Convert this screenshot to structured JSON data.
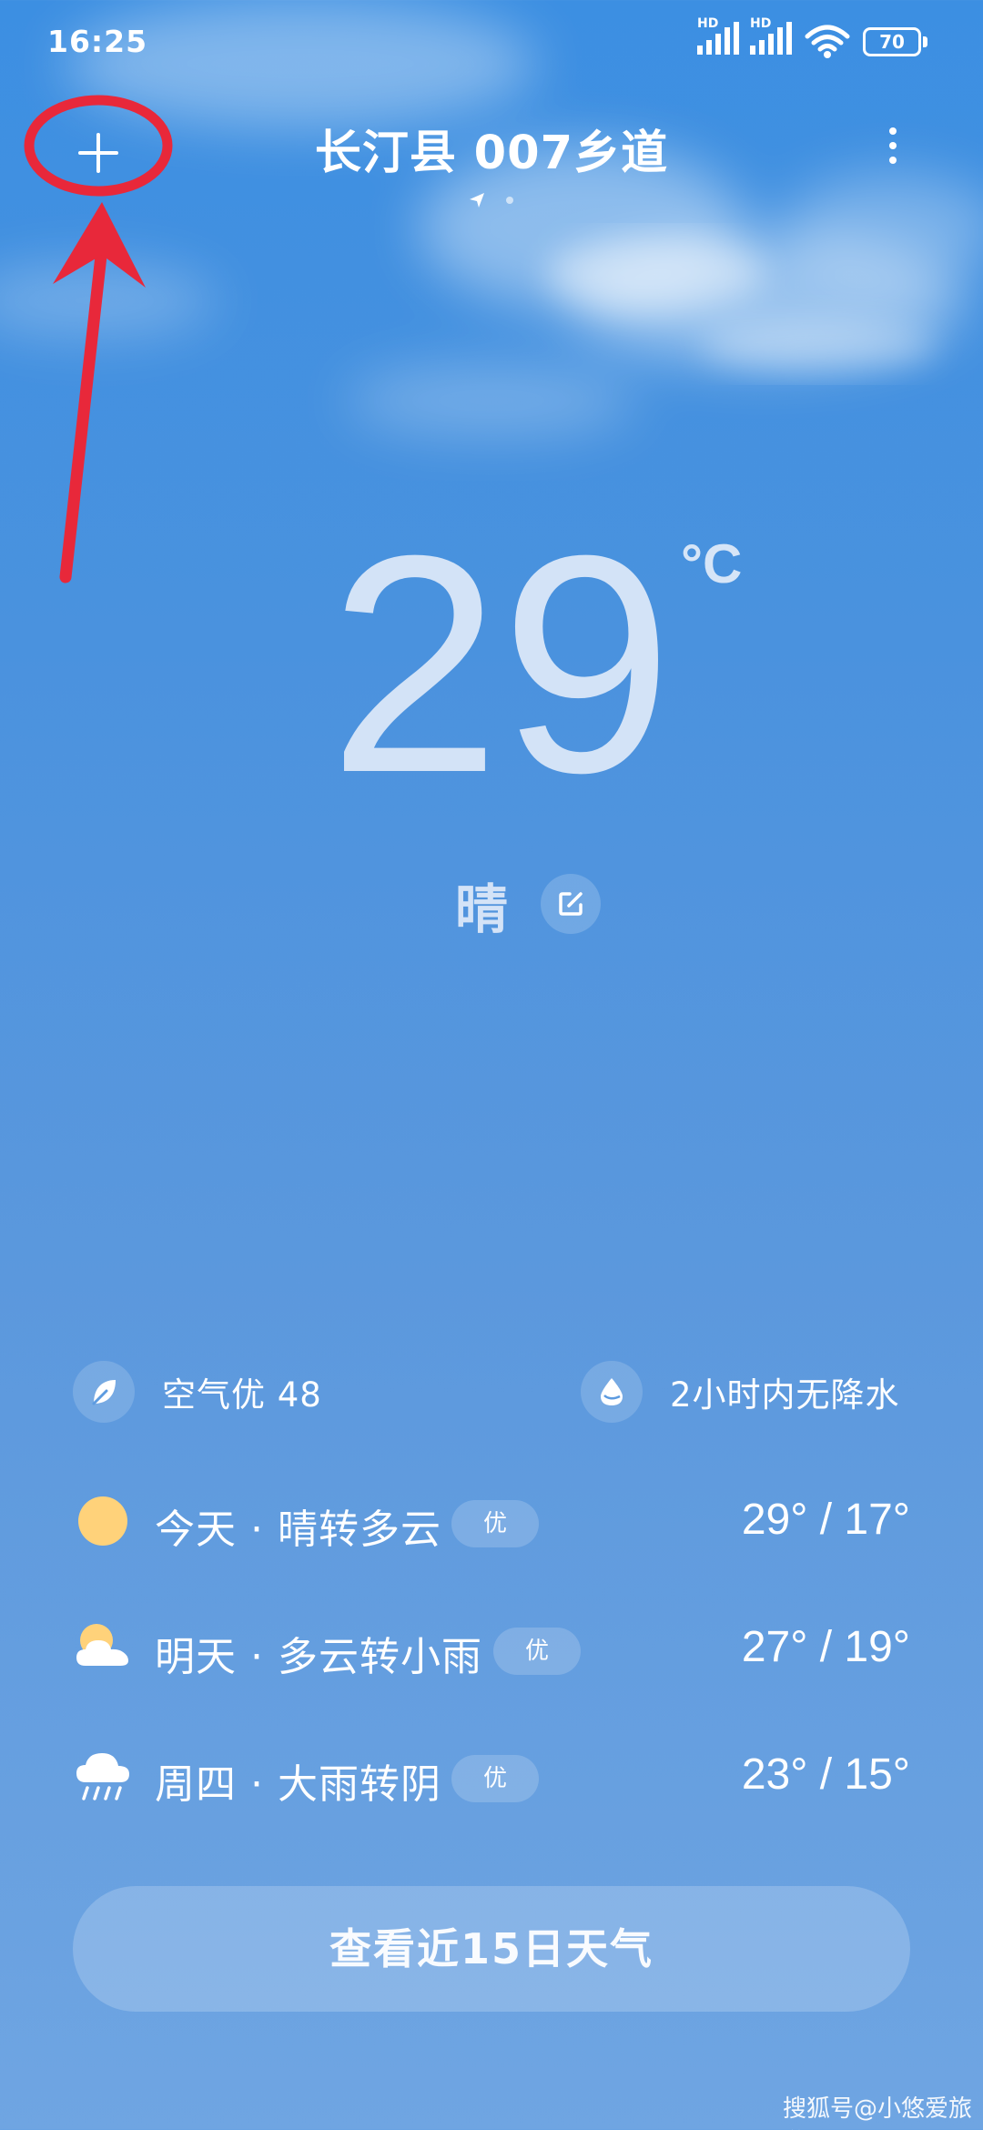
{
  "status_bar": {
    "time": "16:25",
    "signal_1_label": "HD",
    "signal_2_label": "HD",
    "battery": "70"
  },
  "header": {
    "add_icon": "plus-icon",
    "location": "长汀县 007乡道",
    "more_icon": "more-vertical-icon"
  },
  "current": {
    "temperature": "29",
    "unit": "°C",
    "condition": "晴"
  },
  "info": {
    "air_quality": "空气优 48",
    "precipitation": "2小时内无降水"
  },
  "forecast": [
    {
      "icon": "sunny-icon",
      "day": "今天 · 晴转多云",
      "aqi": "优",
      "temp": "29° / 17°"
    },
    {
      "icon": "partly-cloudy-icon",
      "day": "明天 · 多云转小雨",
      "aqi": "优",
      "temp": "27° / 19°"
    },
    {
      "icon": "rain-icon",
      "day": "周四 · 大雨转阴",
      "aqi": "优",
      "temp": "23° / 15°"
    }
  ],
  "cta_label": "查看近15日天气",
  "watermark": "搜狐号@小悠爱旅游",
  "colors": {
    "sky_top": "#3c8fe2",
    "sky_bottom": "#6fa5e2",
    "annotation_red": "#e8283a",
    "sun_yellow": "#ffd27a"
  }
}
